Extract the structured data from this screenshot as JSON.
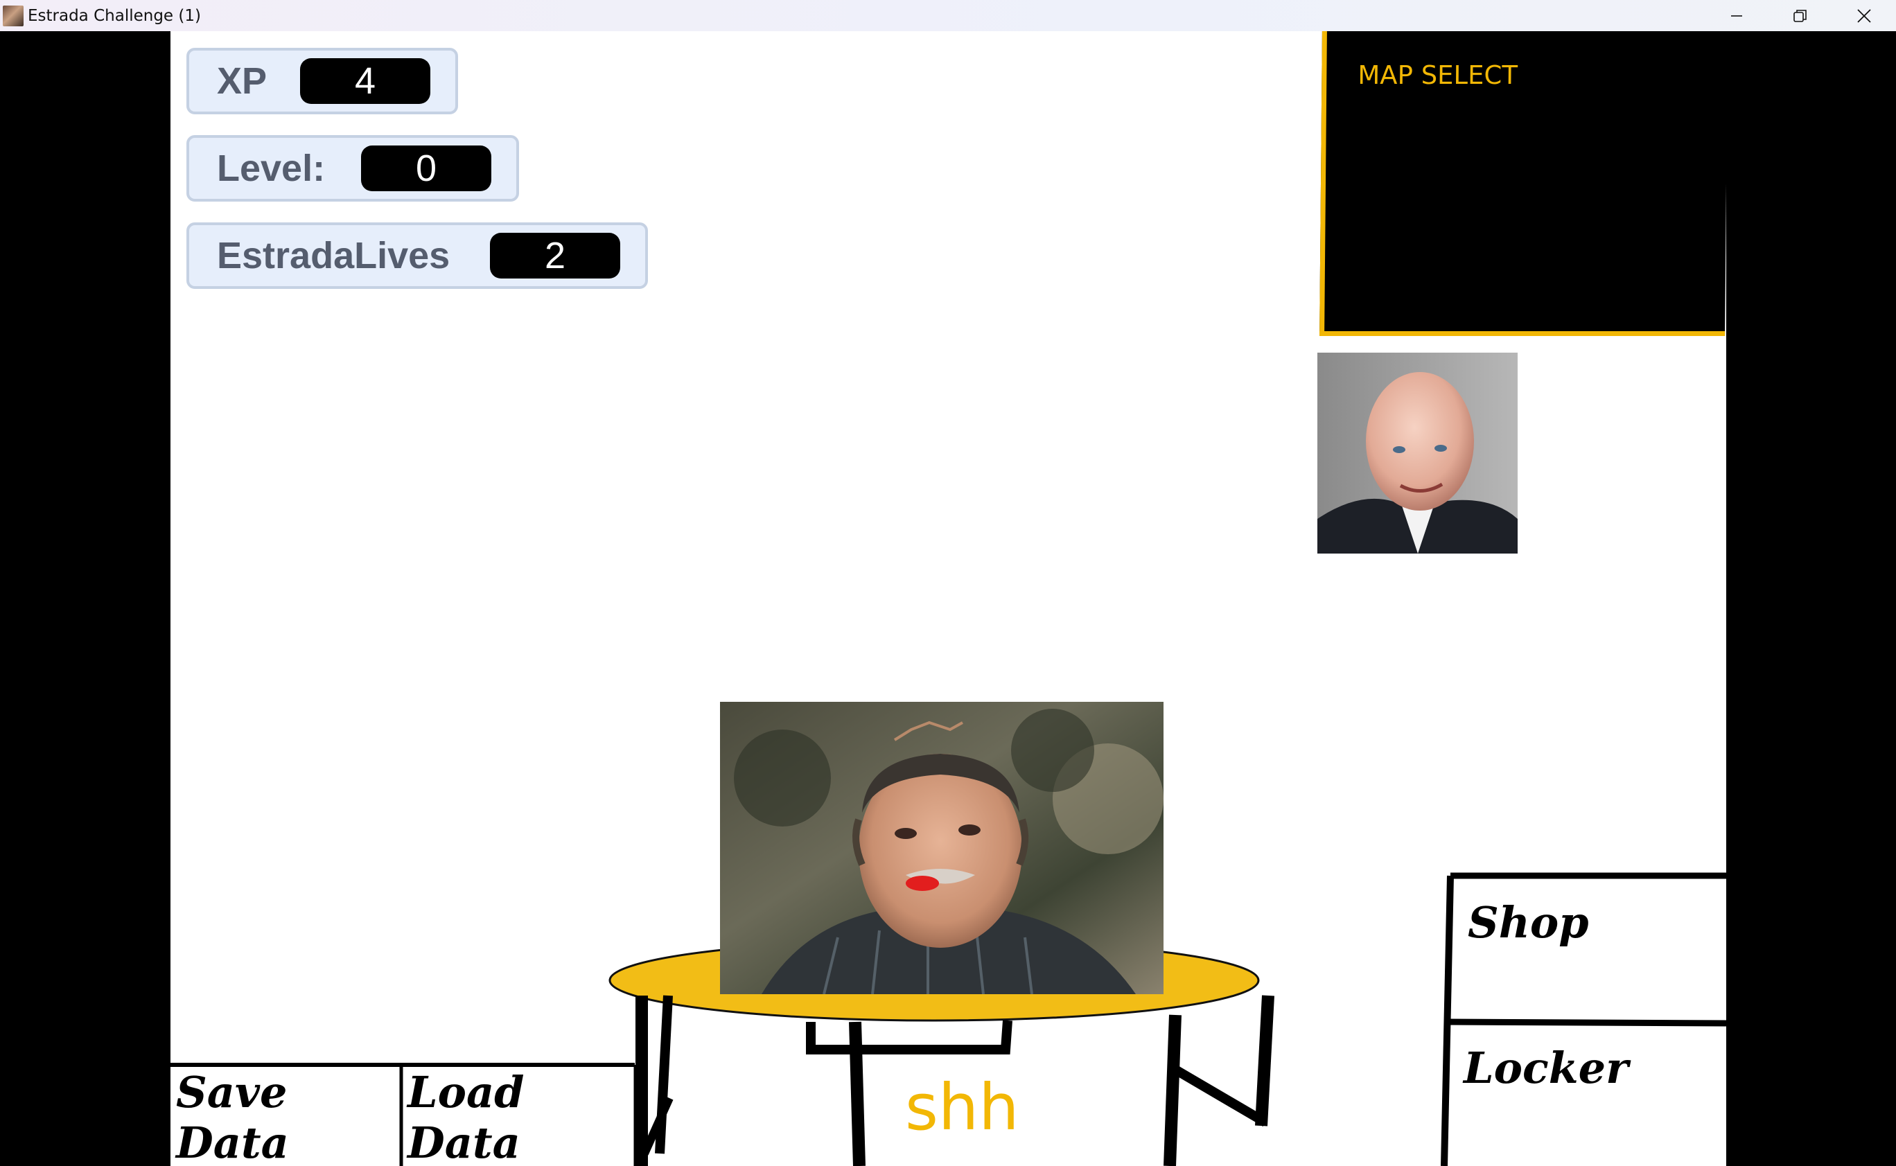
{
  "window": {
    "title": "Estrada Challenge (1)"
  },
  "stats": {
    "xp": {
      "label": "XP",
      "value": "4"
    },
    "level": {
      "label": "Level:",
      "value": "0"
    },
    "lives": {
      "label": "EstradaLives",
      "value": "2"
    }
  },
  "map_select": {
    "label": "MAP SELECT"
  },
  "buttons": {
    "save": "Save Data",
    "load": "Load Data",
    "shop": "Shop",
    "locker": "Locker"
  },
  "table_text": "shh",
  "colors": {
    "accent": "#f2b705",
    "stat_bg": "#e6eefb",
    "stat_border": "#c5d1e3"
  }
}
